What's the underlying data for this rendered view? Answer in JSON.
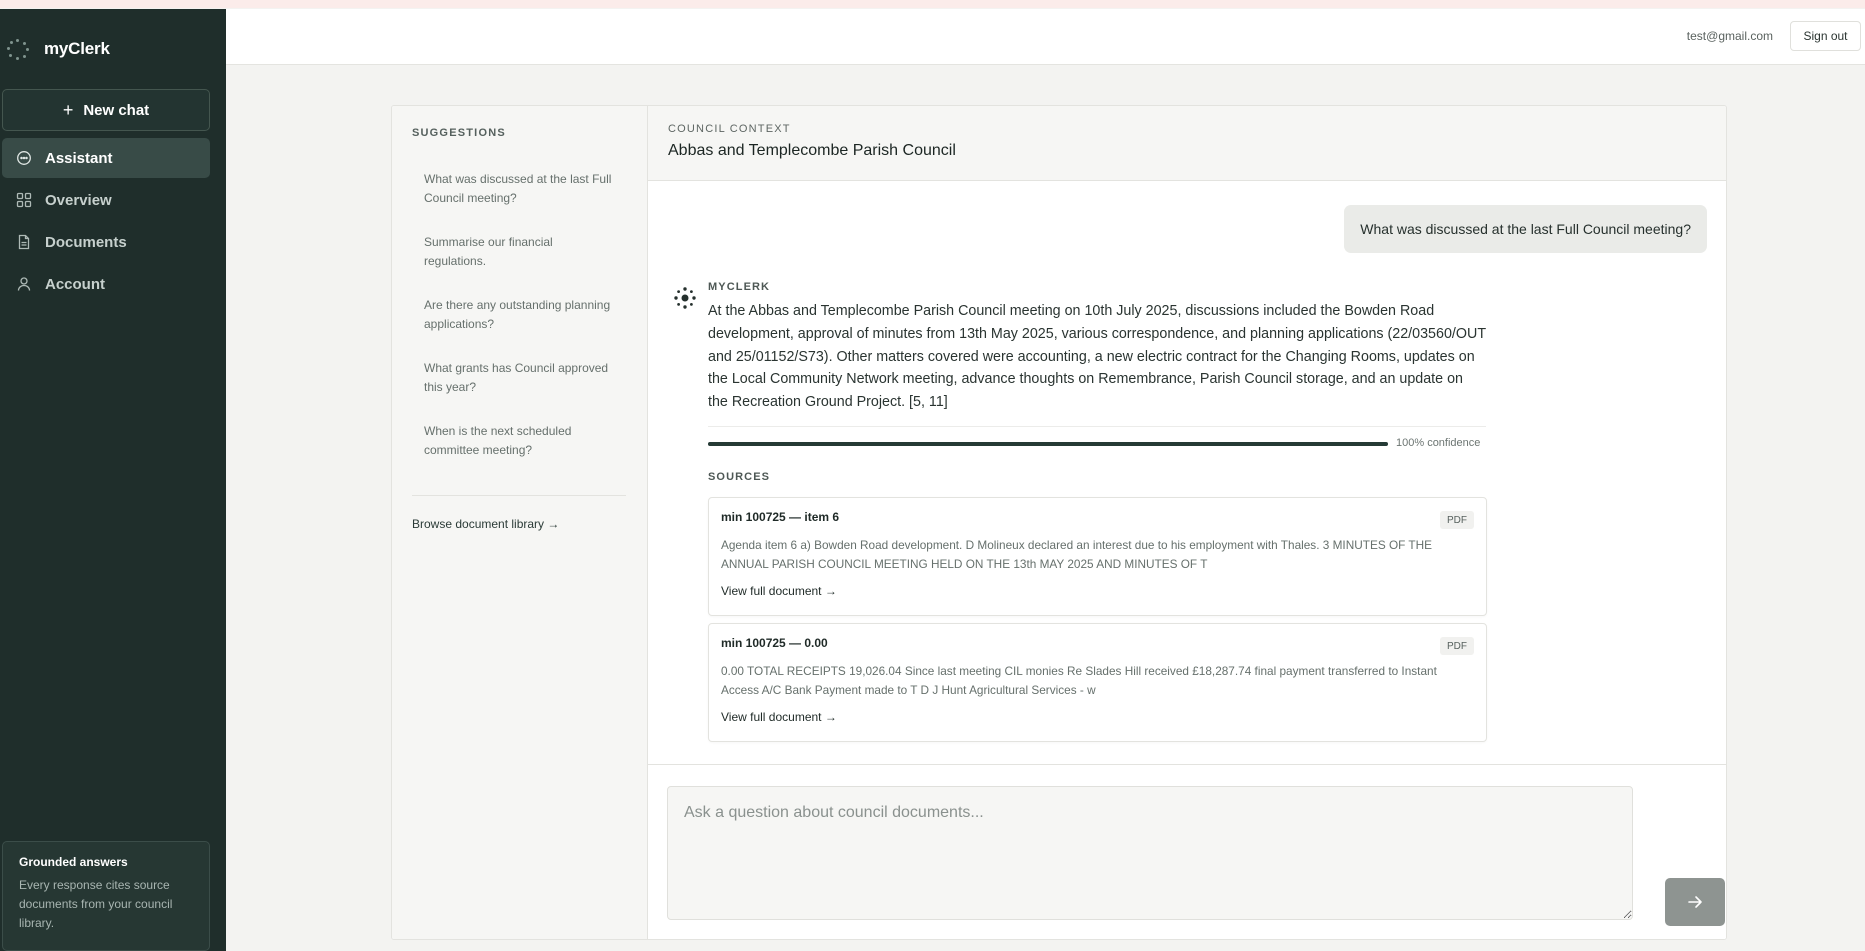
{
  "brand": {
    "name": "myClerk"
  },
  "sidebar": {
    "new_chat_label": "New chat",
    "items": [
      {
        "label": "Assistant",
        "icon": "chat-bubble-icon",
        "active": true
      },
      {
        "label": "Overview",
        "icon": "grid-icon",
        "active": false
      },
      {
        "label": "Documents",
        "icon": "document-icon",
        "active": false
      },
      {
        "label": "Account",
        "icon": "user-icon",
        "active": false
      }
    ],
    "grounded": {
      "title": "Grounded answers",
      "text": "Every response cites source documents from your council library."
    }
  },
  "header": {
    "email": "test@gmail.com",
    "signout_label": "Sign out"
  },
  "suggestions": {
    "title": "SUGGESTIONS",
    "items": [
      "What was discussed at the last Full Council meeting?",
      "Summarise our financial regulations.",
      "Are there any outstanding planning applications?",
      "What grants has Council approved this year?",
      "When is the next scheduled committee meeting?"
    ],
    "browse_label": "Browse document library →"
  },
  "context": {
    "label": "COUNCIL CONTEXT",
    "name": "Abbas and Templecombe Parish Council"
  },
  "chat": {
    "user_message": "What was discussed at the last Full Council meeting?",
    "assistant_label": "MYCLERK",
    "assistant_message": "At the Abbas and Templecombe Parish Council meeting on 10th July 2025, discussions included the Bowden Road development, approval of minutes from 13th May 2025, various correspondence, and planning applications (22/03560/OUT and 25/01152/S73). Other matters covered were accounting, a new electric contract for the Changing Rooms, updates on the Local Community Network meeting, advance thoughts on Remembrance, Parish Council storage, and an update on the Recreation Ground Project. [5, 11]",
    "confidence": 1.0,
    "confidence_label": "100% confidence",
    "sources_title": "SOURCES",
    "sources": [
      {
        "title": "min 100725 — item 6",
        "badge": "PDF",
        "excerpt": "Agenda item 6 a) Bowden Road development. D Molineux declared an interest due to his employment with Thales. 3 MINUTES OF THE ANNUAL PARISH COUNCIL MEETING HELD ON THE 13th MAY 2025 AND MINUTES OF T",
        "link": "View full document →"
      },
      {
        "title": "min 100725 — 0.00",
        "badge": "PDF",
        "excerpt": "0.00 TOTAL RECEIPTS 19,026.04 Since last meeting CIL monies Re Slades Hill received £18,287.74 final payment transferred to Instant Access A/C Bank Payment made to T D J Hunt Agricultural Services - w",
        "link": "View full document →"
      }
    ]
  },
  "composer": {
    "placeholder": "Ask a question about council documents...",
    "send_icon": "arrow-right-icon"
  },
  "colors": {
    "sidebar_bg": "#1f2e2b",
    "accent": "#253a35",
    "send_button": "#8e9491"
  }
}
